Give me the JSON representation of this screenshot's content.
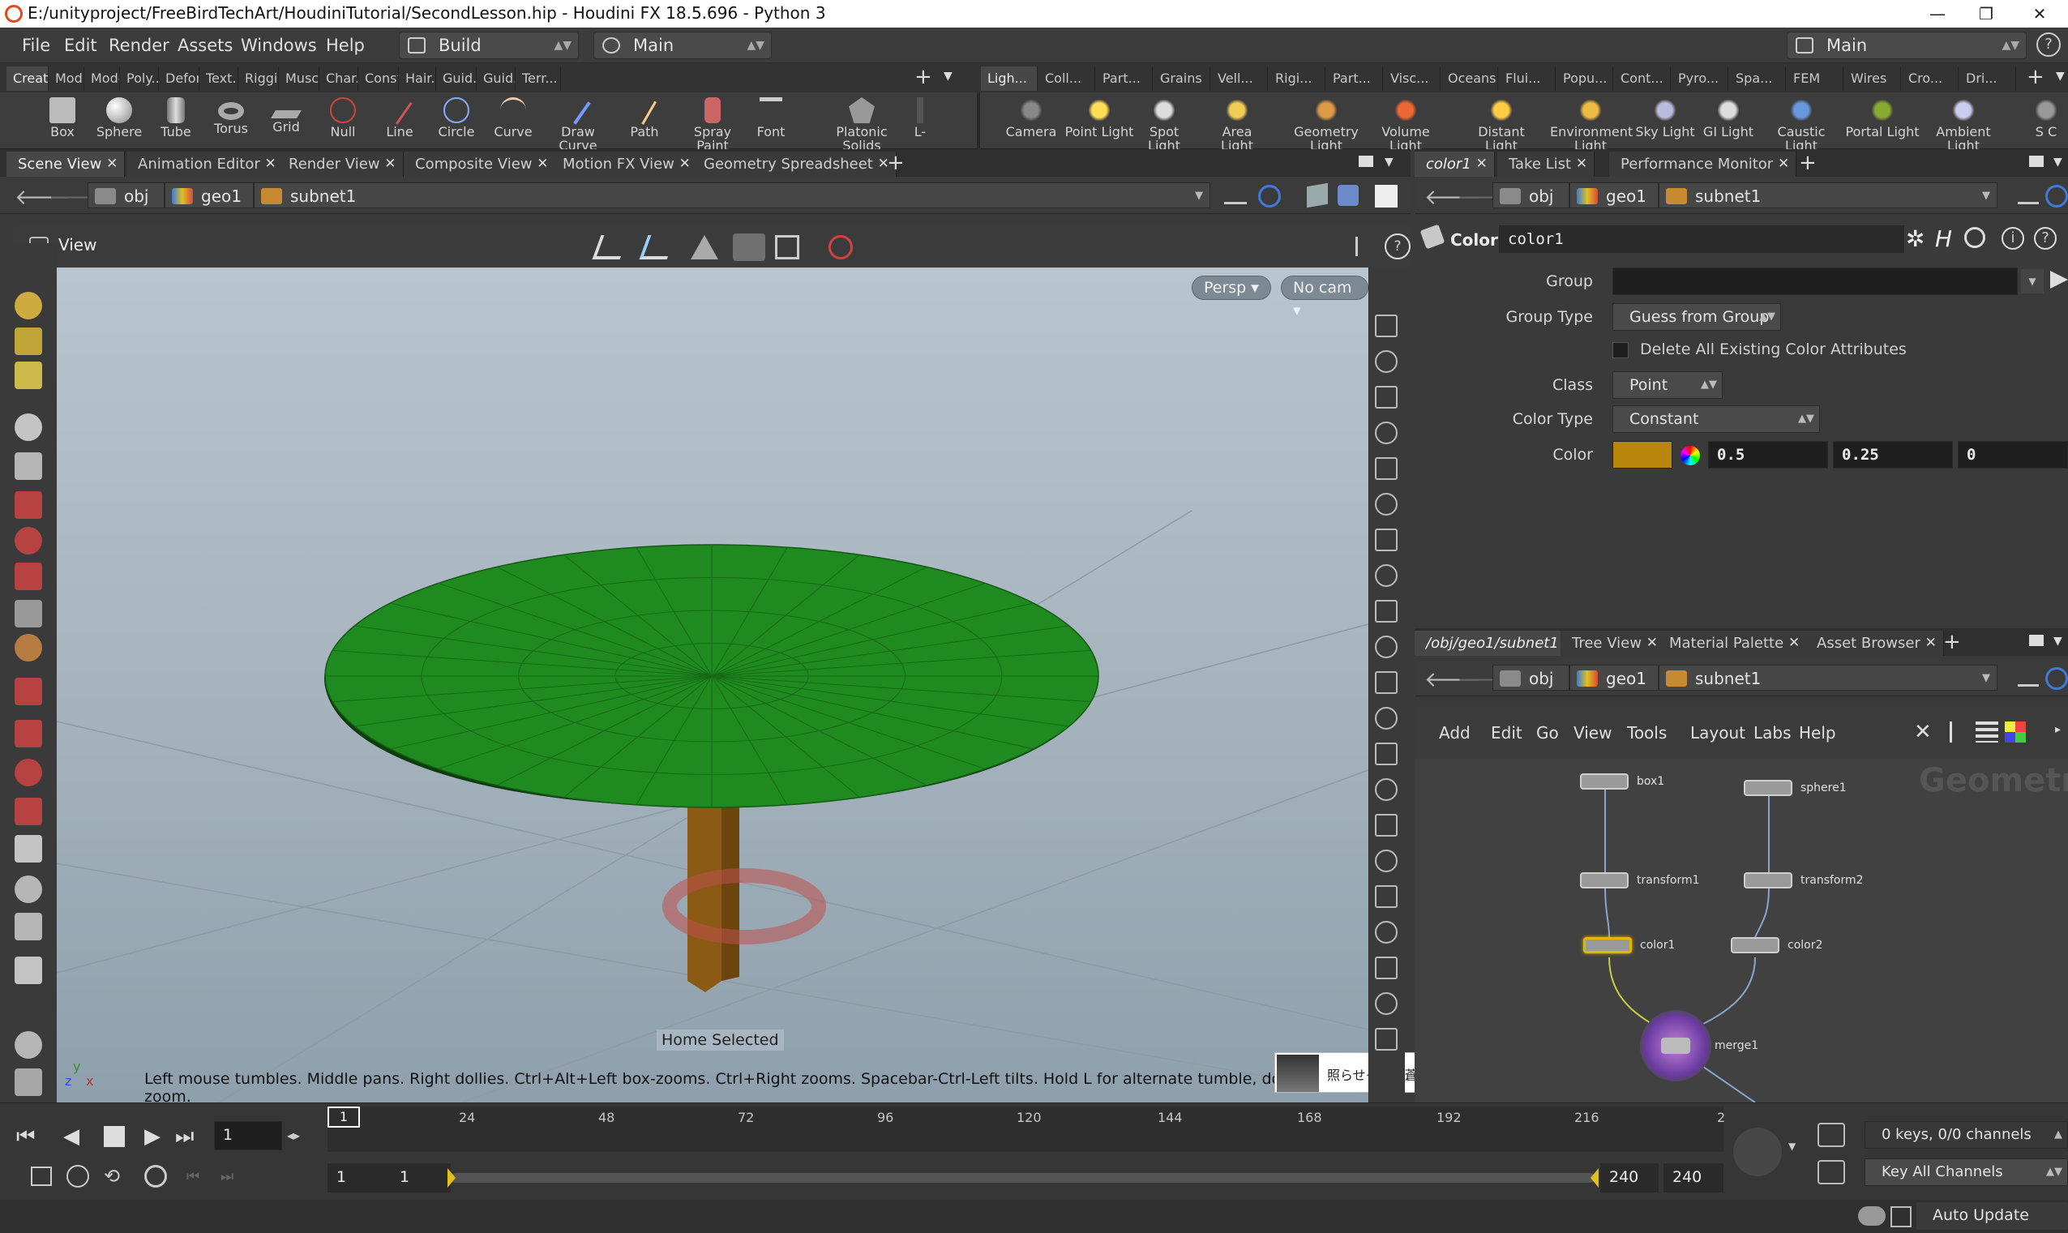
{
  "window": {
    "title": "E:/unityproject/FreeBirdTechArt/HoudiniTutorial/SecondLesson.hip - Houdini FX 18.5.696 - Python 3",
    "controls": [
      "—",
      "❐",
      "✕"
    ]
  },
  "menubar": {
    "items": [
      "File",
      "Edit",
      "Render",
      "Assets",
      "Windows",
      "Help"
    ],
    "desktop": "Build",
    "runtime": "Main",
    "right_desktop": "Main"
  },
  "shelf_tabs_left": [
    "Create",
    "Modify",
    "Model",
    "Poly...",
    "Deform",
    "Text...",
    "Riggi...",
    "Muscles",
    "Char...",
    "Const...",
    "Hair...",
    "Guid...",
    "Guid...",
    "Terr..."
  ],
  "shelf_tabs_right": [
    "Ligh...",
    "Coll...",
    "Part...",
    "Grains",
    "Vell...",
    "Rigi...",
    "Part...",
    "Visc...",
    "Oceans",
    "Flui...",
    "Popu...",
    "Cont...",
    "Pyro...",
    "Spa...",
    "FEM",
    "Wires",
    "Cro...",
    "Dri..."
  ],
  "shelf_tools_left": [
    "Box",
    "Sphere",
    "Tube",
    "Torus",
    "Grid",
    "Null",
    "Line",
    "Circle",
    "Curve",
    "Draw Curve",
    "Path",
    "Spray Paint",
    "Font",
    "Platonic Solids",
    "L-"
  ],
  "shelf_tools_right": [
    "Camera",
    "Point Light",
    "Spot Light",
    "Area Light",
    "Geometry Light",
    "Volume Light",
    "Distant Light",
    "Environment Light",
    "Sky Light",
    "GI Light",
    "Caustic Light",
    "Portal Light",
    "Ambient Light",
    "S C"
  ],
  "left_pane": {
    "tabs": [
      "Scene View",
      "Animation Editor",
      "Render View",
      "Composite View",
      "Motion FX View",
      "Geometry Spreadsheet"
    ],
    "path": [
      "obj",
      "geo1",
      "subnet1"
    ],
    "view_label": "View",
    "persp_button": "Persp",
    "cam_button": "No cam",
    "home_selected": "Home Selected",
    "hint": "Left mouse tumbles. Middle pans. Right dollies. Ctrl+Alt+Left box-zooms. Ctrl+Right zooms. Spacebar-Ctrl-Left tilts. Hold L for alternate tumble, dolly, and zoom.",
    "axis_y": "y",
    "axis_x": "x",
    "axis_z": "z"
  },
  "notification": {
    "text": "照らせそこの蒼いネーチャ",
    "heart": "❤",
    "sound": "🔊",
    "menu": "☰",
    "close": "×"
  },
  "param_pane": {
    "tabs": [
      "color1",
      "Take List",
      "Performance Monitor"
    ],
    "path": [
      "obj",
      "geo1",
      "subnet1"
    ],
    "node_type": "Color",
    "node_name": "color1",
    "params": {
      "group_label": "Group",
      "group_value": "",
      "group_type_label": "Group Type",
      "group_type_value": "Guess from Group",
      "delete_label": "Delete All Existing Color Attributes",
      "class_label": "Class",
      "class_value": "Point",
      "color_type_label": "Color Type",
      "color_type_value": "Constant",
      "color_label": "Color",
      "color_r": "0.5",
      "color_g": "0.25",
      "color_b": "0",
      "swatch": "#b8860b"
    }
  },
  "network_pane": {
    "tabs": [
      "/obj/geo1/subnet1",
      "Tree View",
      "Material Palette",
      "Asset Browser"
    ],
    "path": [
      "obj",
      "geo1",
      "subnet1"
    ],
    "menu": [
      "Add",
      "Edit",
      "Go",
      "View",
      "Tools",
      "Layout",
      "Labs",
      "Help"
    ],
    "context_label": "Geometry",
    "nodes": [
      "box1",
      "sphere1",
      "transform1",
      "transform2",
      "color1",
      "color2",
      "merge1"
    ]
  },
  "timeline": {
    "frame": "1",
    "ticks": [
      "1",
      "24",
      "48",
      "72",
      "96",
      "120",
      "144",
      "168",
      "192",
      "216",
      "2"
    ],
    "range_start": "1",
    "range_start2": "1",
    "range_end": "240",
    "range_end2": "240",
    "keys_label": "0 keys, 0/0 channels",
    "key_all": "Key All Channels"
  },
  "status": {
    "auto_update": "Auto Update"
  },
  "colors": {
    "accent": "#e0a800",
    "canopy": "#1f8a1f",
    "trunk": "#8b5a14"
  }
}
